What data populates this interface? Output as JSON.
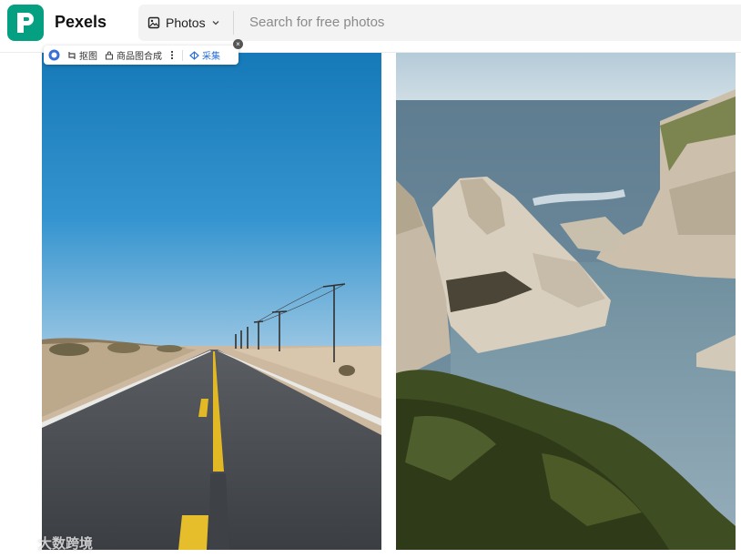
{
  "header": {
    "brand": "Pexels",
    "search": {
      "type_label": "Photos",
      "placeholder": "Search for free photos"
    }
  },
  "extension_toolbar": {
    "items": [
      "抠图",
      "商品图合成",
      "采集"
    ]
  },
  "watermark": {
    "text": "大数跨境"
  },
  "photos": [
    {
      "subject": "desert highway"
    },
    {
      "subject": "coastal rocks"
    }
  ],
  "colors": {
    "brand": "#05a081",
    "sky_left": "#1e7bb8",
    "sea_right": "#6e8c9c"
  }
}
